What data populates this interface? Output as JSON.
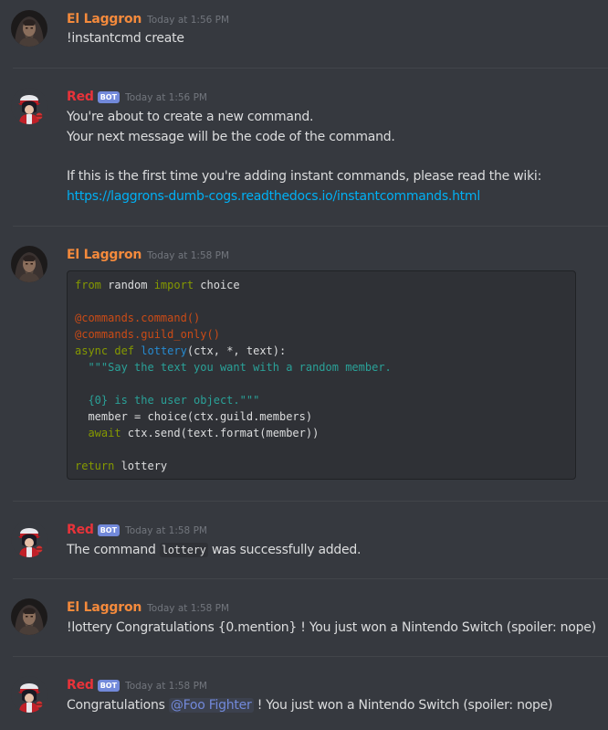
{
  "messages": [
    {
      "author": "El Laggron",
      "timestamp": "Today at 1:56 PM",
      "lines": [
        "!instantcmd create"
      ]
    },
    {
      "author": "Red",
      "bot_tag": "BOT",
      "timestamp": "Today at 1:56 PM",
      "lines": [
        "You're about to create a new command.",
        "Your next message will be the code of the command.",
        "If this is the first time you're adding instant commands, please read the wiki:"
      ],
      "link": "https://laggrons-dumb-cogs.readthedocs.io/instantcommands.html"
    },
    {
      "author": "El Laggron",
      "timestamp": "Today at 1:58 PM",
      "code": {
        "l1_from": "from",
        "l1_mod": " random ",
        "l1_import": "import",
        "l1_name": " choice",
        "l3": "@commands.command()",
        "l4": "@commands.guild_only()",
        "l5_async": "async",
        "l5_sp": " ",
        "l5_def": "def",
        "l5_sp2": " ",
        "l5_fn": "lottery",
        "l5_args": "(ctx, *, text):",
        "l6": "  \"\"\"Say the text you want with a random member.",
        "l8": "  {0} is the user object.\"\"\"",
        "l9": "  member = choice(ctx.guild.members)",
        "l10_indent": "  ",
        "l10_await": "await",
        "l10_rest": " ctx.send(text.format(member))",
        "l12_return": "return",
        "l12_rest": " lottery"
      }
    },
    {
      "author": "Red",
      "bot_tag": "BOT",
      "timestamp": "Today at 1:58 PM",
      "pre": "The command ",
      "code_word": "lottery",
      "post": " was successfully added."
    },
    {
      "author": "El Laggron",
      "timestamp": "Today at 1:58 PM",
      "lines": [
        "!lottery Congratulations {0.mention} ! You just won a Nintendo Switch (spoiler: nope)"
      ]
    },
    {
      "author": "Red",
      "bot_tag": "BOT",
      "timestamp": "Today at 1:58 PM",
      "pre": "Congratulations ",
      "mention": "@Foo Fighter",
      "post": " ! You just won a Nintendo Switch (spoiler: nope)"
    }
  ],
  "colors": {
    "background": "#36393f",
    "el_laggron_name": "#f48a3c",
    "red_name": "#e8333a",
    "bot_tag": "#7289da",
    "link": "#00b0f4",
    "codeblock_bg": "#2f3136"
  },
  "icons": {
    "el_laggron_avatar": "hooded-figure-avatar",
    "red_avatar": "red-trainer-avatar"
  }
}
